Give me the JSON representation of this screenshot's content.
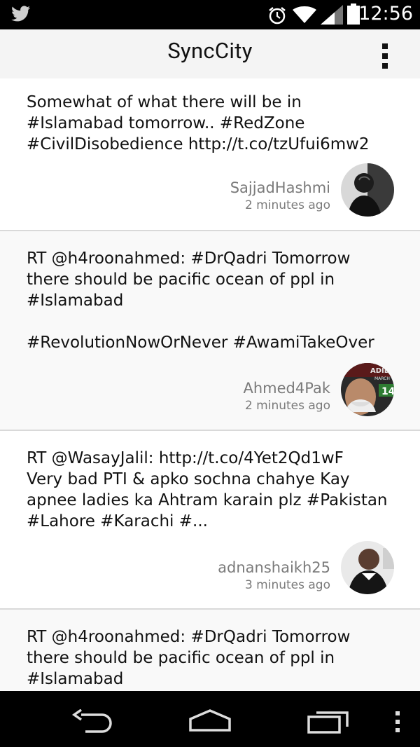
{
  "status_bar": {
    "time": "12:56",
    "icons": [
      "twitter-icon",
      "alarm-icon",
      "wifi-icon",
      "signal-icon",
      "battery-icon"
    ]
  },
  "action_bar": {
    "title": "SyncCity",
    "overflow_icon": "more-vert-icon"
  },
  "tweets": [
    {
      "text": "Somewhat of what there will be in\n#Islamabad tomorrow.. #RedZone\n#CivilDisobedience http://t.co/tzUfui6mw2",
      "user": "SajjadHashmi",
      "time_ago": "2 minutes ago"
    },
    {
      "text": "RT @h4roonahmed: #DrQadri Tomorrow\nthere should be pacific ocean of ppl in\n#Islamabad\n\n#RevolutionNowOrNever #AwamiTakeOver",
      "user": "Ahmed4Pak",
      "time_ago": "2 minutes ago",
      "avatar_text": [
        "ADILA",
        "MARCH",
        "14"
      ]
    },
    {
      "text": "RT @WasayJalil: http://t.co/4Yet2Qd1wF\nVery bad PTI & apko sochna chahye Kay\napnee ladies ka Ahtram karain plz #Pakistan\n#Lahore #Karachi #...",
      "user": "adnanshaikh25",
      "time_ago": "3 minutes ago"
    },
    {
      "text": "RT @h4roonahmed: #DrQadri Tomorrow\nthere should be pacific ocean of ppl in\n#Islamabad",
      "user": "",
      "time_ago": ""
    }
  ],
  "nav_bar": {
    "icons": [
      "back-icon",
      "home-icon",
      "recents-icon",
      "menu-icon"
    ]
  }
}
